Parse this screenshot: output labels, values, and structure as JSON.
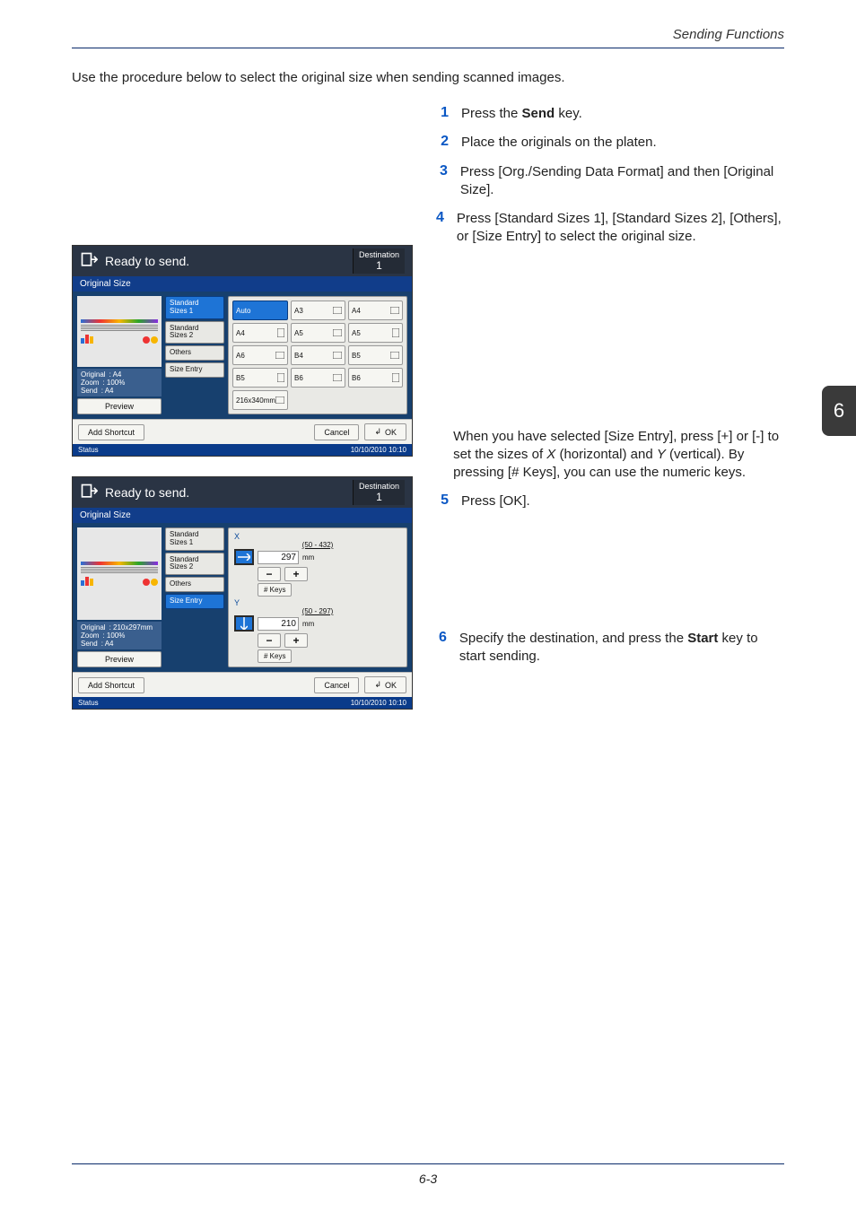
{
  "header": {
    "section": "Sending Functions"
  },
  "intro": "Use the procedure below to select the original size when sending scanned images.",
  "steps": {
    "s1": {
      "n": "1",
      "pre": "Press the ",
      "bold": "Send",
      "post": " key."
    },
    "s2": {
      "n": "2",
      "text": "Place the originals on the platen."
    },
    "s3": {
      "n": "3",
      "text": "Press [Org./Sending Data Format] and then [Original Size]."
    },
    "s4": {
      "n": "4",
      "text": "Press [Standard Sizes 1], [Standard Sizes 2], [Others], or [Size Entry] to select the original size."
    },
    "s4b": {
      "text": "When you have selected [Size Entry], press [+] or [-] to set the sizes of X (horizontal) and Y (vertical). By pressing [# Keys], you can use the numeric keys."
    },
    "s5": {
      "n": "5",
      "text": "Press [OK]."
    },
    "s6": {
      "n": "6",
      "pre": "Specify the destination, and press the ",
      "bold": "Start",
      "post": " key to start sending."
    }
  },
  "side_tab": "6",
  "footer": "6-3",
  "panel1": {
    "title": "Ready to send.",
    "dest_label": "Destination",
    "dest_count": "1",
    "subhead": "Original Size",
    "info": {
      "original_l": "Original",
      "original_v": ": A4",
      "zoom_l": "Zoom",
      "zoom_v": ": 100%",
      "send_l": "Send",
      "send_v": ": A4"
    },
    "preview": "Preview",
    "tabs": {
      "t1a": "Standard",
      "t1b": "Sizes 1",
      "t2a": "Standard",
      "t2b": "Sizes 2",
      "t3": "Others",
      "t4": "Size Entry"
    },
    "sizes": {
      "auto": "Auto",
      "a3": "A3",
      "a4l": "A4",
      "a4p": "A4",
      "a5p": "A5",
      "a5l": "A5",
      "a6": "A6",
      "b4": "B4",
      "b5l": "B5",
      "b5p": "B5",
      "b6p": "B6",
      "b6l": "B6",
      "x216": "216x340mm"
    },
    "add_shortcut": "Add Shortcut",
    "cancel": "Cancel",
    "ok": "OK",
    "status": "Status",
    "timestamp": "10/10/2010  10:10"
  },
  "panel2": {
    "title": "Ready to send.",
    "dest_label": "Destination",
    "dest_count": "1",
    "subhead": "Original Size",
    "info": {
      "original_l": "Original",
      "original_v": ": 210x297mm",
      "zoom_l": "Zoom",
      "zoom_v": ": 100%",
      "send_l": "Send",
      "send_v": ": A4"
    },
    "preview": "Preview",
    "tabs": {
      "t1a": "Standard",
      "t1b": "Sizes 1",
      "t2a": "Standard",
      "t2b": "Sizes 2",
      "t3": "Others",
      "t4": "Size Entry"
    },
    "x": {
      "label": "X",
      "range": "(50 - 432)",
      "value": "297",
      "unit": "mm",
      "keys": "# Keys"
    },
    "y": {
      "label": "Y",
      "range": "(50 - 297)",
      "value": "210",
      "unit": "mm",
      "keys": "# Keys"
    },
    "add_shortcut": "Add Shortcut",
    "cancel": "Cancel",
    "ok": "OK",
    "status": "Status",
    "timestamp": "10/10/2010  10:10"
  }
}
